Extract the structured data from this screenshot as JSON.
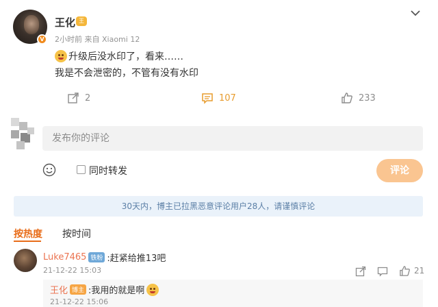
{
  "post": {
    "author": "王化",
    "author_badge": "王",
    "meta": "2小时前 来自 Xiaomi 12",
    "text_line1": "升级后没水印了，看来……",
    "text_line2": "我是不会泄密的，不管有没有水印",
    "reposts": "2",
    "comments": "107",
    "likes": "233"
  },
  "composer": {
    "placeholder": "发布你的评论",
    "repost_checkbox_label": "同时转发",
    "submit_label": "评论"
  },
  "notice": "30天内，博主已拉黑恶意评论用户28人，请谨慎评论",
  "tabs": [
    {
      "label": "按热度",
      "active": true
    },
    {
      "label": "按时间",
      "active": false
    }
  ],
  "comments": [
    {
      "user": "Luke7465",
      "badge": "铁粉",
      "text": ":赶紧给推13吧",
      "time": "21-12-22 15:03",
      "likes": "21",
      "reply": {
        "user": "王化",
        "badge": "博主",
        "text": ":我用的就是啊",
        "time": "21-12-22 15:06"
      }
    }
  ],
  "colors": {
    "accent": "#e86c18",
    "comment_accent": "#e79b2c",
    "submit_disabled": "#fac591",
    "notice_bg": "#eaf2fa",
    "username": "#eb7350"
  },
  "icons": [
    "verified-badge-icon",
    "crown-icon",
    "chevron-down-icon",
    "share-icon",
    "comment-icon",
    "like-icon",
    "emoji-icon",
    "reply-icon",
    "more-icon"
  ]
}
